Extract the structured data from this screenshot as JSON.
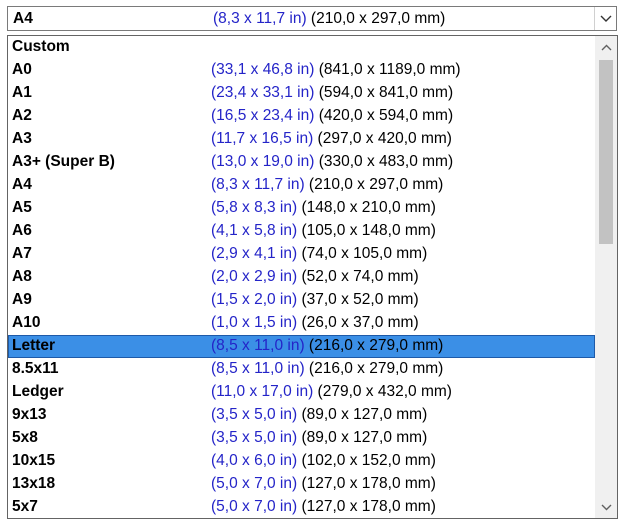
{
  "combo": {
    "selected_name": "A4",
    "selected_in": "(8,3 x 11,7 in)",
    "selected_mm": " (210,0 x 297,0 mm)"
  },
  "items": [
    {
      "name": "Custom",
      "in": "",
      "mm": ""
    },
    {
      "name": "A0",
      "in": "(33,1 x 46,8 in)",
      "mm": " (841,0 x 1189,0 mm)"
    },
    {
      "name": "A1",
      "in": "(23,4 x 33,1 in)",
      "mm": " (594,0 x 841,0 mm)"
    },
    {
      "name": "A2",
      "in": "(16,5 x 23,4 in)",
      "mm": " (420,0 x 594,0 mm)"
    },
    {
      "name": "A3",
      "in": "(11,7 x 16,5 in)",
      "mm": " (297,0 x 420,0 mm)"
    },
    {
      "name": "A3+ (Super B)",
      "in": "(13,0 x 19,0 in)",
      "mm": " (330,0 x 483,0 mm)"
    },
    {
      "name": "A4",
      "in": "(8,3 x 11,7 in)",
      "mm": " (210,0 x 297,0 mm)"
    },
    {
      "name": "A5",
      "in": "(5,8 x 8,3 in)",
      "mm": " (148,0 x 210,0 mm)"
    },
    {
      "name": "A6",
      "in": "(4,1 x 5,8 in)",
      "mm": " (105,0 x 148,0 mm)"
    },
    {
      "name": "A7",
      "in": "(2,9 x 4,1 in)",
      "mm": " (74,0 x 105,0 mm)"
    },
    {
      "name": "A8",
      "in": "(2,0 x 2,9 in)",
      "mm": " (52,0 x 74,0 mm)"
    },
    {
      "name": "A9",
      "in": "(1,5 x 2,0 in)",
      "mm": " (37,0 x 52,0 mm)"
    },
    {
      "name": "A10",
      "in": "(1,0 x 1,5 in)",
      "mm": " (26,0 x 37,0 mm)"
    },
    {
      "name": "Letter",
      "in": "(8,5 x 11,0 in)",
      "mm": " (216,0 x 279,0 mm)",
      "selected": true
    },
    {
      "name": "8.5x11",
      "in": "(8,5 x 11,0 in)",
      "mm": " (216,0 x 279,0 mm)"
    },
    {
      "name": "Ledger",
      "in": "(11,0 x 17,0 in)",
      "mm": " (279,0 x 432,0 mm)"
    },
    {
      "name": "9x13",
      "in": "(3,5 x 5,0 in)",
      "mm": " (89,0 x 127,0 mm)"
    },
    {
      "name": "5x8",
      "in": "(3,5 x 5,0 in)",
      "mm": " (89,0 x 127,0 mm)"
    },
    {
      "name": "10x15",
      "in": "(4,0 x 6,0 in)",
      "mm": " (102,0 x 152,0 mm)"
    },
    {
      "name": "13x18",
      "in": "(5,0 x 7,0 in)",
      "mm": " (127,0 x 178,0 mm)"
    },
    {
      "name": "5x7",
      "in": "(5,0 x 7,0 in)",
      "mm": " (127,0 x 178,0 mm)"
    }
  ],
  "scrollbar": {
    "up_icon": "chevron-up-icon",
    "down_icon": "chevron-down-icon",
    "position": 0
  },
  "colors": {
    "inch_text": "#2424c8",
    "selection": "#3b8fe6"
  }
}
